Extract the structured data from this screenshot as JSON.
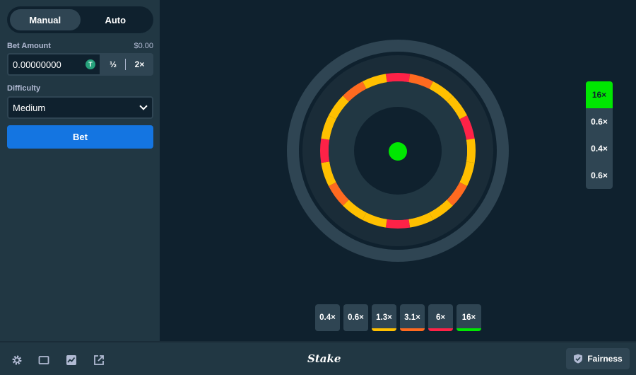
{
  "sidebar": {
    "modes": [
      {
        "label": "Manual",
        "active": true
      },
      {
        "label": "Auto",
        "active": false
      }
    ],
    "bet_amount_label": "Bet Amount",
    "bet_amount_usd": "$0.00",
    "bet_amount_value": "0.00000000",
    "coin_symbol": "T",
    "half_label": "½",
    "double_label": "2×",
    "difficulty_label": "Difficulty",
    "difficulty_value": "Medium",
    "bet_button_label": "Bet"
  },
  "wheel": {
    "colors": {
      "yellow": "#ffc000",
      "orange": "#ff6a20",
      "red": "#fe2247",
      "center": "#00e701"
    },
    "segments": [
      "red",
      "orange",
      "yellow",
      "yellow",
      "red",
      "yellow",
      "yellow",
      "orange",
      "yellow",
      "yellow",
      "red",
      "yellow",
      "yellow",
      "orange",
      "yellow",
      "red",
      "yellow",
      "yellow",
      "orange",
      "yellow"
    ]
  },
  "payout_stack": [
    "16×",
    "0.6×",
    "0.4×",
    "0.6×"
  ],
  "multipliers": [
    {
      "label": "0.4×",
      "color": "#2f4553"
    },
    {
      "label": "0.6×",
      "color": "#2f4553"
    },
    {
      "label": "1.3×",
      "color": "#ffc000"
    },
    {
      "label": "3.1×",
      "color": "#ff6a20"
    },
    {
      "label": "6×",
      "color": "#fe2247"
    },
    {
      "label": "16×",
      "color": "#00e701"
    }
  ],
  "footer": {
    "icons": [
      "gear-icon",
      "theatre-mode-icon",
      "stats-icon",
      "popout-icon"
    ],
    "logo_text": "Stake",
    "fairness_label": "Fairness"
  }
}
